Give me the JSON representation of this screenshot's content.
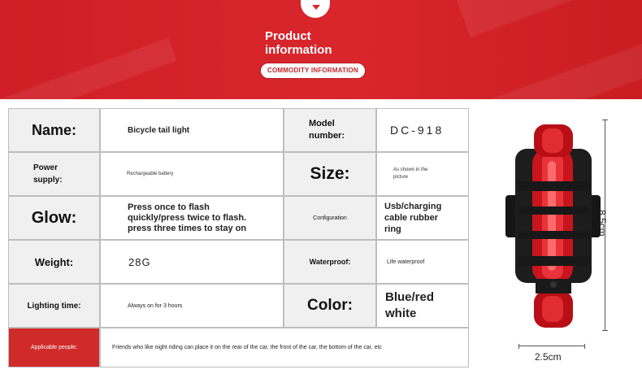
{
  "header": {
    "title": "Product\ninformation",
    "pill": "COMMODITY INFORMATION"
  },
  "specs": {
    "name_label": "Name:",
    "name_value": "Bicycle tail light",
    "model_label": "Model\nnumber:",
    "model_value": "DC-918",
    "power_label": "Power\nsupply:",
    "power_value": "Rechargeable battery",
    "size_label": "Size:",
    "size_value": "As shown in the\npicture",
    "glow_label": "Glow:",
    "glow_value": "Press once to flash\nquickly/press twice to flash.\npress three times to stay on",
    "config_label": "Configuration",
    "config_value": "Usb/charging\ncable rubber\nring",
    "weight_label": "Weight:",
    "weight_value": "28G",
    "waterproof_label": "Waterproof:",
    "waterproof_value": "Life waterproof",
    "lighting_label": "Lighting time:",
    "lighting_value": "Always on for 3 hours",
    "color_label": "Color:",
    "color_value": "Blue/red\nwhite",
    "applicable_label": "Applicable people:",
    "applicable_value": "Friends who like night riding can place it on the rear of the car, the front of the car, the bottom of the car, etc"
  },
  "dimensions": {
    "height": "8.5cm",
    "width": "2.5cm"
  },
  "colors": {
    "brand_red": "#d8262c",
    "label_gray": "#f0f0f0"
  }
}
